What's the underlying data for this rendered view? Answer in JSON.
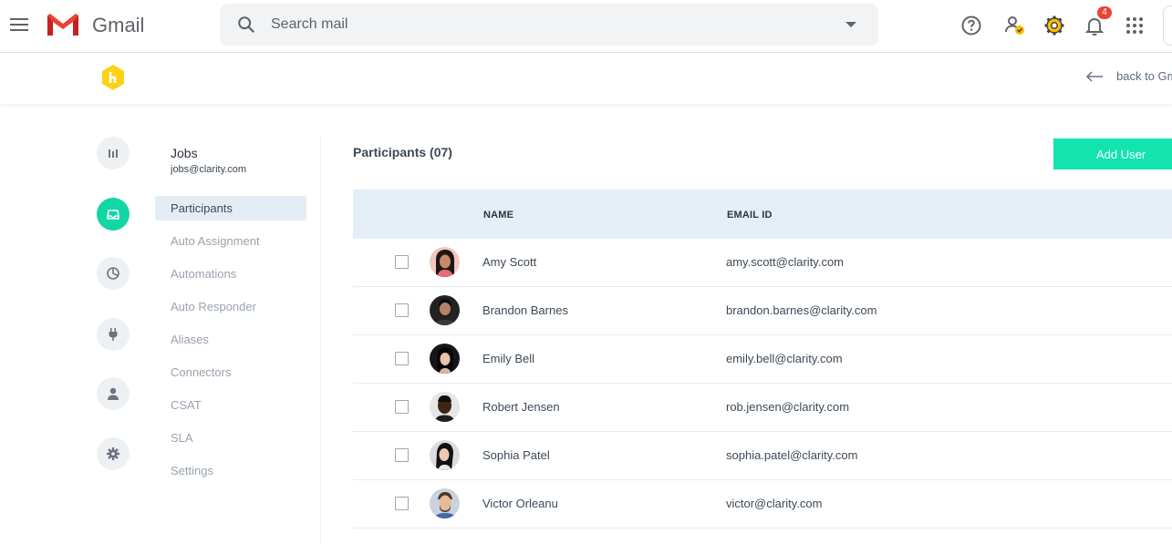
{
  "gmail": {
    "brand": "Gmail",
    "search_placeholder": "Search mail",
    "notification_count": "4"
  },
  "header": {
    "back_label": "back to Gmail"
  },
  "nav": {
    "title": "Jobs",
    "subtitle": "jobs@clarity.com",
    "items": [
      {
        "label": "Participants"
      },
      {
        "label": "Auto Assignment"
      },
      {
        "label": "Automations"
      },
      {
        "label": "Auto Responder"
      },
      {
        "label": "Aliases"
      },
      {
        "label": "Connectors"
      },
      {
        "label": "CSAT"
      },
      {
        "label": "SLA"
      },
      {
        "label": "Settings"
      }
    ]
  },
  "rail_icons": [
    "bar-chart-icon",
    "inbox-icon",
    "pie-chart-icon",
    "plug-icon",
    "user-icon",
    "gear-icon"
  ],
  "main": {
    "title": "Participants (07)",
    "add_button": "Add User",
    "columns": {
      "name": "NAME",
      "email": "EMAIL ID"
    },
    "rows": [
      {
        "name": "Amy Scott",
        "email": "amy.scott@clarity.com"
      },
      {
        "name": "Brandon Barnes",
        "email": "brandon.barnes@clarity.com"
      },
      {
        "name": "Emily Bell",
        "email": "emily.bell@clarity.com"
      },
      {
        "name": "Robert Jensen",
        "email": "rob.jensen@clarity.com"
      },
      {
        "name": "Sophia Patel",
        "email": "sophia.patel@clarity.com"
      },
      {
        "name": "Victor Orleanu",
        "email": "victor@clarity.com"
      }
    ]
  },
  "colors": {
    "accent": "#13e4ae",
    "active_rail": "#13d6a5",
    "logo_yellow": "#fcd116",
    "table_header": "#e5eef6"
  }
}
